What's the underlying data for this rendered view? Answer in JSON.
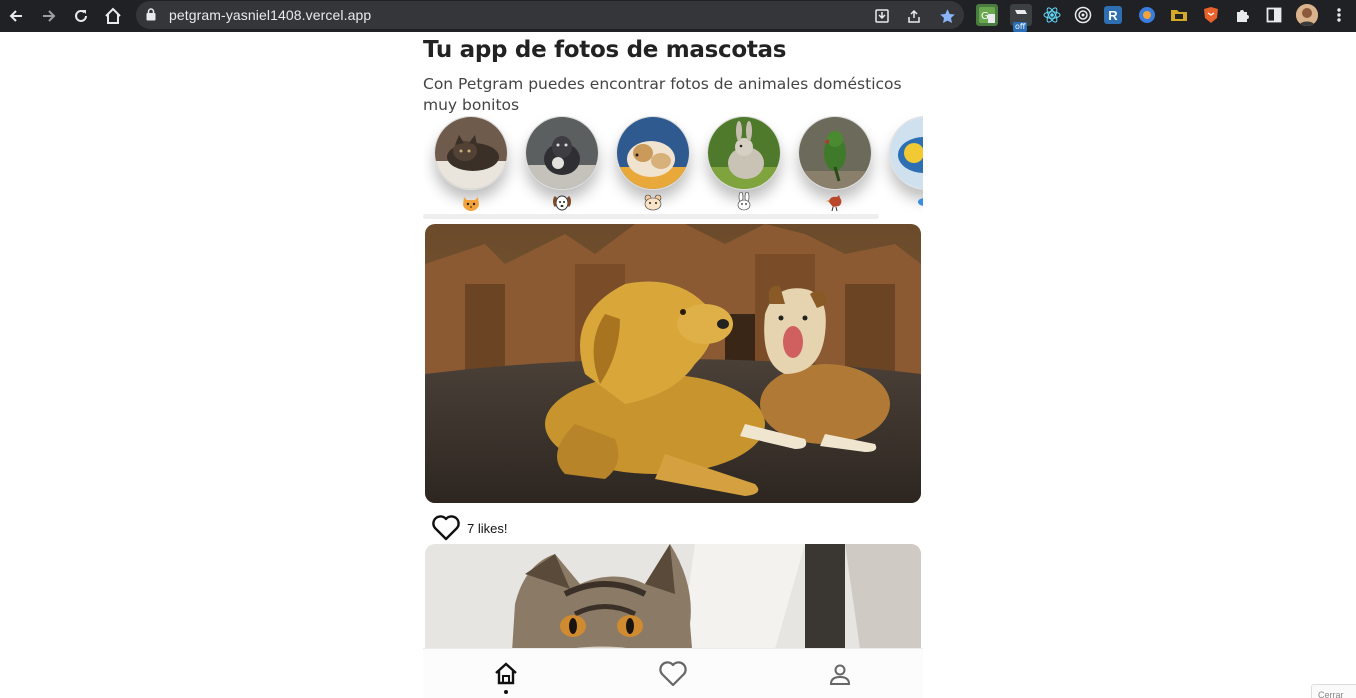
{
  "browser": {
    "url": "petgram-yasniel1408.vercel.app",
    "extensions": [
      "translate-extension-icon",
      "off-badge-extension-icon",
      "react-devtools-icon",
      "target-extension-icon",
      "r-extension-icon",
      "circle-extension-icon",
      "folder-extension-icon",
      "brave-shield-icon",
      "puzzle-extensions-icon"
    ],
    "off_badge": "off",
    "r_ext_label": "R",
    "accent_star": "#8ab4f8"
  },
  "app": {
    "title": "Tu app de fotos de mascotas",
    "subtitle": "Con Petgram puedes encontrar fotos de animales domésticos muy bonitos",
    "categories": [
      {
        "name": "cats",
        "emoji": "🐱"
      },
      {
        "name": "dogs",
        "emoji": "🐶"
      },
      {
        "name": "hamsters",
        "emoji": "🐹"
      },
      {
        "name": "rabbits",
        "emoji": "🐰"
      },
      {
        "name": "birds",
        "emoji": "🐦"
      },
      {
        "name": "fish",
        "emoji": "🐠"
      }
    ],
    "photos": [
      {
        "subject": "two dogs in front of a cathedral",
        "likes_text": "7 likes!"
      },
      {
        "subject": "tabby cat"
      }
    ],
    "nav": [
      "home",
      "favorites",
      "user"
    ]
  },
  "corner_label": "Cerrar"
}
